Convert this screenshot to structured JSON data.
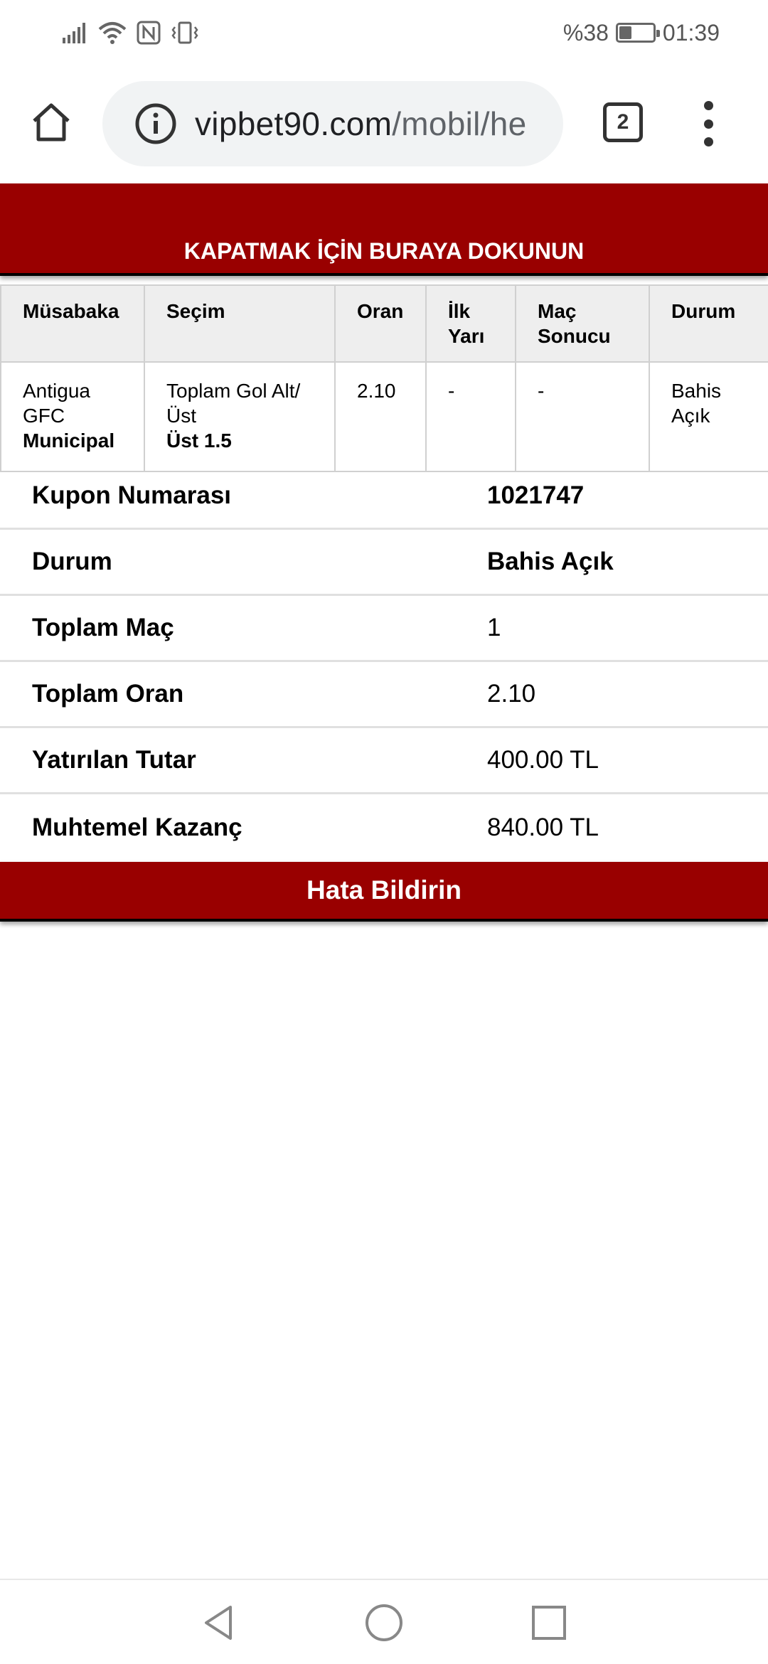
{
  "status_bar": {
    "battery_text": "%38",
    "battery_level": 0.38,
    "time": "01:39"
  },
  "browser": {
    "url_host": "vipbet90.com",
    "url_path": "/mobil/he",
    "tab_count": "2"
  },
  "banner": {
    "close_text": "KAPATMAK İÇİN BURAYA DOKUNUN"
  },
  "bet_table": {
    "headers": [
      "Müsabaka",
      "Seçim",
      "Oran",
      "İlk Yarı",
      "Maç Sonucu",
      "Durum"
    ],
    "row": {
      "match_line1": "Antigua GFC",
      "match_line2": "Municipal",
      "selection_line1": "Toplam Gol Alt/Üst",
      "selection_line2": "Üst 1.5",
      "odds": "2.10",
      "first_half": "-",
      "match_result": "-",
      "status": "Bahis Açık"
    }
  },
  "summary": [
    {
      "label": "Kupon Numarası",
      "value": "1021747"
    },
    {
      "label": "Durum",
      "value": "Bahis Açık"
    },
    {
      "label": "Toplam Maç",
      "value": "1"
    },
    {
      "label": "Toplam Oran",
      "value": "2.10"
    },
    {
      "label": "Yatırılan Tutar",
      "value": "400.00 TL"
    },
    {
      "label": "Muhtemel Kazanç",
      "value": "840.00 TL"
    }
  ],
  "report_button": "Hata Bildirin",
  "icons": {
    "home": "home-icon",
    "info": "info-icon",
    "menu": "more-vert-icon",
    "back": "back-icon",
    "home_nav": "home-nav-icon",
    "recents": "recents-icon"
  },
  "colors": {
    "accent": "#990000",
    "header_bg": "#eeeeee"
  }
}
